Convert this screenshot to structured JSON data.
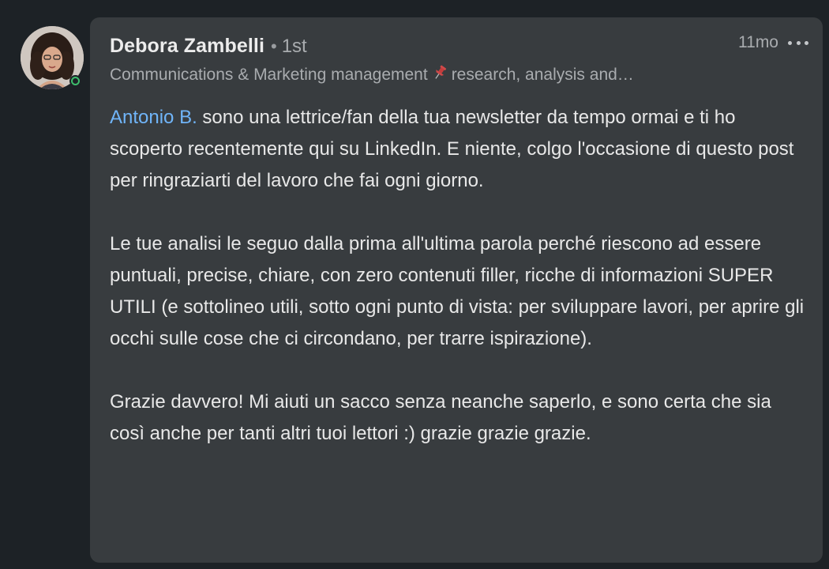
{
  "comment": {
    "author": {
      "name": "Debora Zambelli",
      "separator": "•",
      "degree": "1st",
      "headline_before_icon": "Communications & Marketing management",
      "headline_icon": "pushpin-icon",
      "headline_after_icon": "research, analysis and…",
      "online": true
    },
    "timestamp": "11mo",
    "more_icon": "more-options-icon",
    "mention": "Antonio B.",
    "paragraph1_rest": " sono una lettrice/fan della tua newsletter da tempo ormai e ti ho scoperto recentemente qui su LinkedIn. E niente, colgo l'occasione di questo post per ringraziarti del lavoro che fai ogni giorno.",
    "paragraph2": "Le tue analisi le seguo dalla prima all'ultima parola perché riescono ad essere puntuali, precise, chiare, con zero contenuti filler, ricche di informazioni SUPER UTILI (e sottolineo utili, sotto ogni punto di vista: per sviluppare lavori, per aprire gli occhi sulle cose che ci circondano, per trarre ispirazione).",
    "paragraph3": "Grazie davvero! Mi aiuti un sacco senza neanche saperlo, e sono certa che sia così anche per tanti altri tuoi lettori :) grazie grazie grazie."
  },
  "colors": {
    "page_bg": "#1d2226",
    "bubble_bg": "#383c3f",
    "mention": "#70b5f9",
    "online": "#3ebd6c"
  }
}
